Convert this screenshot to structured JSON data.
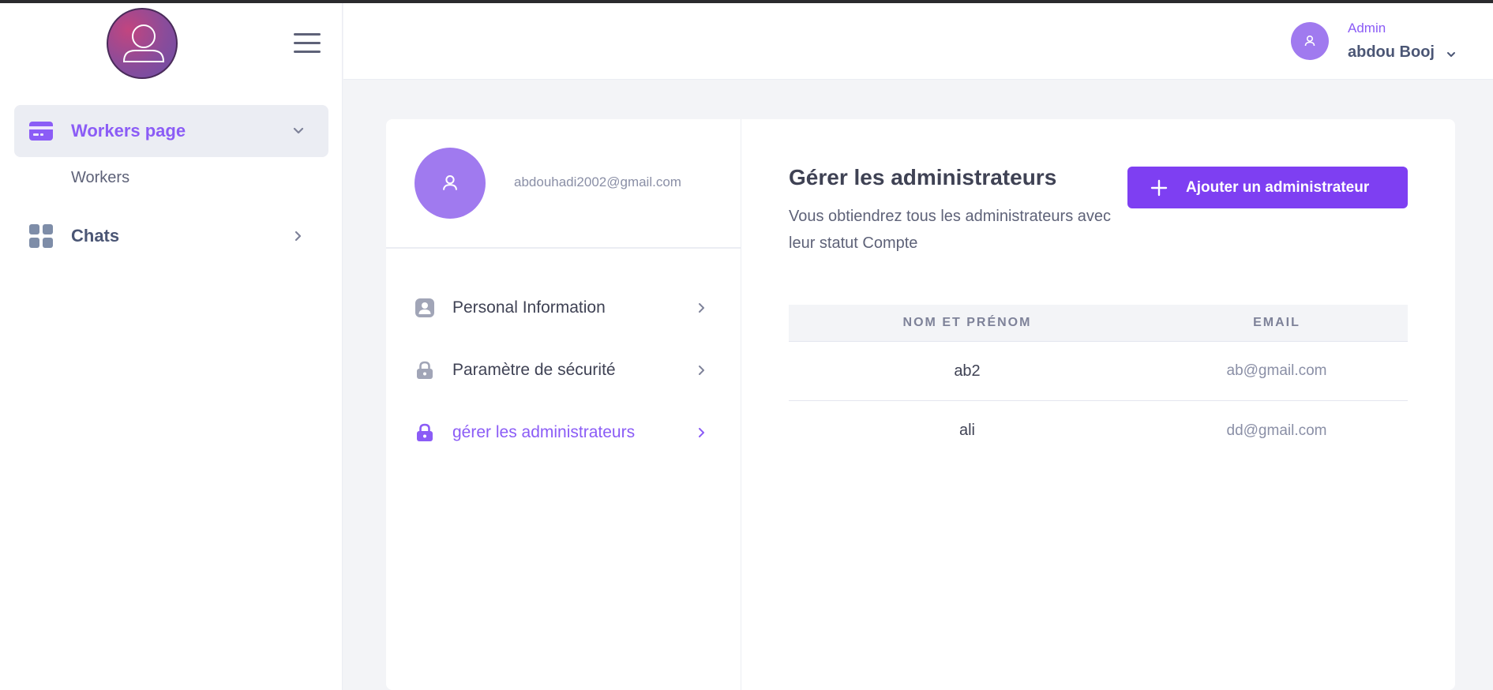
{
  "sidebar": {
    "nav": [
      {
        "label": "Workers page",
        "icon": "credit-card-icon",
        "chevron": "chevron-down-icon",
        "active": true
      },
      {
        "label": "Chats",
        "icon": "grid-icon",
        "chevron": "chevron-right-icon",
        "active": false
      }
    ],
    "sub_items": [
      "Workers"
    ]
  },
  "header": {
    "role": "Admin",
    "name": "abdou Booj"
  },
  "profile": {
    "email": "abdouhadi2002@gmail.com"
  },
  "menu": [
    {
      "label": "Personal Information",
      "icon": "user-square-icon"
    },
    {
      "label": "Paramètre de sécurité",
      "icon": "lock-icon"
    },
    {
      "label": "gérer les administrateurs",
      "icon": "lock-icon",
      "active": true
    }
  ],
  "content": {
    "title": "Gérer les administrateurs",
    "description": "Vous obtiendrez tous les administrateurs avec leur statut Compte",
    "add_button": "Ajouter un administrateur"
  },
  "table": {
    "columns": [
      "NOM ET PRÉNOM",
      "EMAIL"
    ],
    "rows": [
      {
        "name": "ab2",
        "email": "ab@gmail.com"
      },
      {
        "name": "ali",
        "email": "dd@gmail.com"
      }
    ]
  },
  "colors": {
    "accent": "#8b5cf6",
    "button": "#7e3ff2",
    "avatar": "#a07aef",
    "background": "#f3f4f7"
  }
}
